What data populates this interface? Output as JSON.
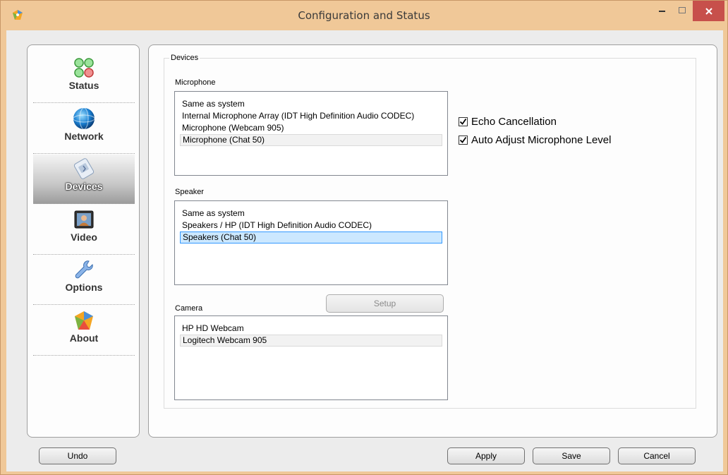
{
  "window": {
    "title": "Configuration and Status",
    "close_glyph": "✕",
    "min_glyph": "‒",
    "max_glyph": "☐"
  },
  "sidebar": {
    "items": [
      {
        "label": "Status",
        "icon": "status-lights-icon"
      },
      {
        "label": "Network",
        "icon": "globe-icon"
      },
      {
        "label": "Devices",
        "icon": "devices-icon",
        "active": true
      },
      {
        "label": "Video",
        "icon": "video-screen-icon"
      },
      {
        "label": "Options",
        "icon": "wrench-icon"
      },
      {
        "label": "About",
        "icon": "about-logo-icon"
      }
    ]
  },
  "devices": {
    "group_title": "Devices",
    "microphone": {
      "label": "Microphone",
      "items": [
        "Same as system",
        "Internal Microphone Array (IDT High Definition Audio CODEC)",
        "Microphone (Webcam 905)",
        "Microphone (Chat 50)"
      ]
    },
    "speaker": {
      "label": "Speaker",
      "items": [
        "Same as system",
        "Speakers / HP (IDT High Definition Audio CODEC)",
        "Speakers (Chat 50)"
      ]
    },
    "camera": {
      "label": "Camera",
      "items": [
        "HP HD Webcam",
        "Logitech Webcam 905"
      ],
      "setup_label": "Setup"
    },
    "echo_cancellation": {
      "label": "Echo Cancellation",
      "checked": true
    },
    "auto_adjust": {
      "label": "Auto Adjust Microphone Level",
      "checked": true
    }
  },
  "footer": {
    "undo_label": "Undo",
    "apply_label": "Apply",
    "save_label": "Save",
    "cancel_label": "Cancel"
  },
  "colors": {
    "frame": "#f0c898",
    "close_button": "#c7504b",
    "selection": "#cce8ff",
    "selection_border": "#3399ff"
  }
}
